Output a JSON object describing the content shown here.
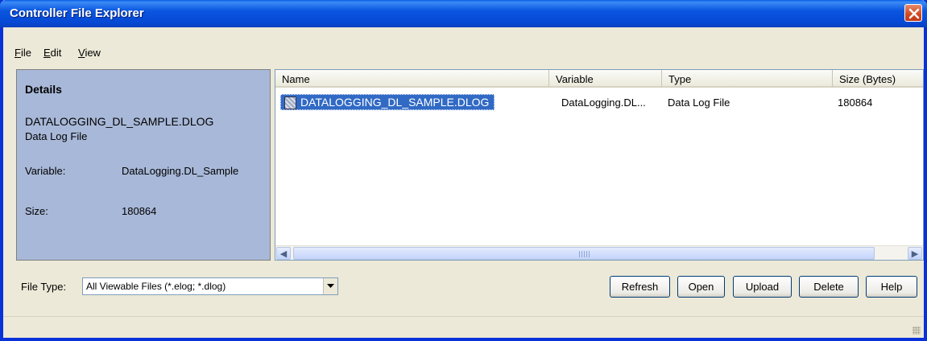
{
  "window": {
    "title": "Controller File Explorer"
  },
  "menu": [
    {
      "key": "F",
      "rest": "ile"
    },
    {
      "key": "E",
      "rest": "dit"
    },
    {
      "key": "V",
      "rest": "iew"
    }
  ],
  "details": {
    "heading": "Details",
    "file_name": "DATALOGGING_DL_SAMPLE.DLOG",
    "file_type": "Data Log File",
    "variable_label": "Variable:",
    "variable_value": "DataLogging.DL_Sample",
    "size_label": "Size:",
    "size_value": "180864"
  },
  "list": {
    "columns": [
      "Name",
      "Variable",
      "Type",
      "Size (Bytes)"
    ],
    "rows": [
      {
        "name": "DATALOGGING_DL_SAMPLE.DLOG",
        "variable": "DataLogging.DL...",
        "type": "Data Log File",
        "size": "180864"
      }
    ]
  },
  "footer": {
    "file_type_label": "File Type:",
    "file_type_value": "All Viewable Files (*.elog; *.dlog)",
    "buttons": [
      "Refresh",
      "Open",
      "Upload",
      "Delete",
      "Help"
    ]
  }
}
